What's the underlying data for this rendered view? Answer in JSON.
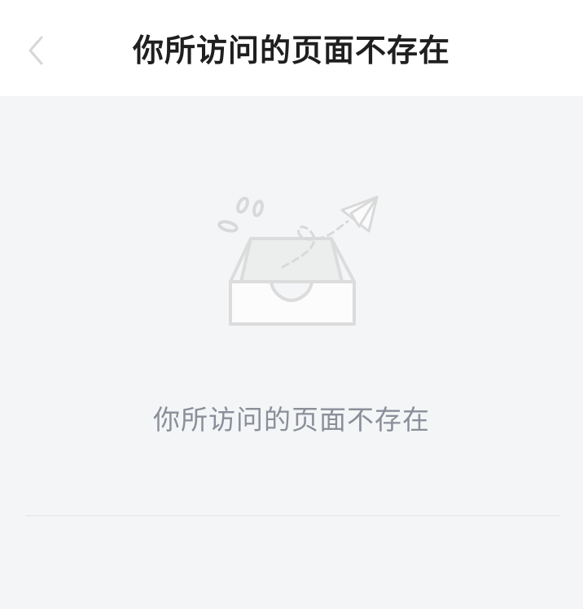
{
  "header": {
    "title": "你所访问的页面不存在",
    "back_icon": "chevron-left-icon"
  },
  "main": {
    "illustration_icon": "empty-inbox-paper-plane-icon",
    "message": "你所访问的页面不存在"
  },
  "colors": {
    "header_background": "#ffffff",
    "page_background": "#f4f5f7",
    "title_text": "#1f1f1f",
    "message_text": "#8a8f99",
    "illustration_stroke": "#d9d9d9",
    "divider": "#e1e3e7"
  }
}
